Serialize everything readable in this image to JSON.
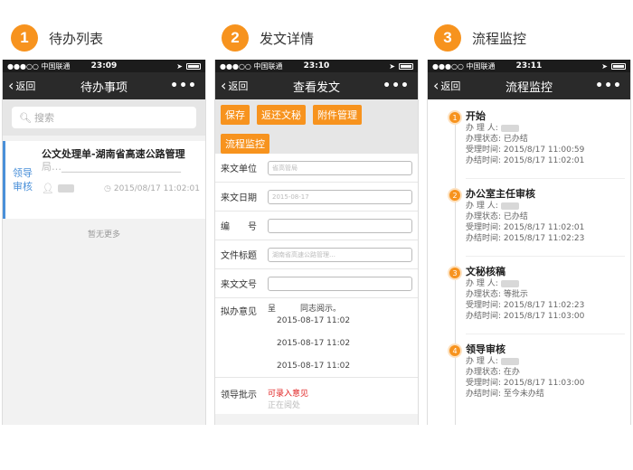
{
  "steps": [
    {
      "num": "1",
      "label": "待办列表"
    },
    {
      "num": "2",
      "label": "发文详情"
    },
    {
      "num": "3",
      "label": "流程监控"
    }
  ],
  "status_bar": {
    "carrier": "●●●○○ 中国联通",
    "times": [
      "23:09",
      "23:10",
      "23:11"
    ]
  },
  "nav": {
    "back_label": "返回",
    "more": "•••",
    "titles": [
      "待办事项",
      "查看发文",
      "流程监控"
    ]
  },
  "todo": {
    "search_placeholder": "搜索",
    "item": {
      "tag_line1": "领导",
      "tag_line2": "审核",
      "title": "公文处理单-湖南省高速公路管理",
      "title_line2": "局…________________________",
      "datetime": "2015/08/17 11:02:01"
    },
    "no_more": "暂无更多"
  },
  "detail": {
    "buttons": [
      "保存",
      "返还文秘",
      "附件管理",
      "流程监控"
    ],
    "fields": [
      {
        "label": "来文单位",
        "value": "省高管局"
      },
      {
        "label": "来文日期",
        "value": "2015-08-17"
      },
      {
        "label": "编　　号",
        "value": ""
      },
      {
        "label": "文件标题",
        "value": "湖南省高速公路管理…"
      },
      {
        "label": "来文文号",
        "value": ""
      }
    ],
    "opinion_label": "拟办意见",
    "opinion_lines": [
      "呈　　　同志阅示。",
      "2015-08-17 11:02",
      "2015-08-17 11:02",
      "2015-08-17 11:02"
    ],
    "leader_label": "领导批示",
    "leader_value": "可录入意见",
    "leader_value2": "正在阅处"
  },
  "flow": {
    "labels": {
      "handler": "办 理 人:",
      "state": "办理状态:",
      "accept": "受理时间:",
      "finish": "办结时间:"
    },
    "steps": [
      {
        "num": "1",
        "name": "开始",
        "state": "已办结",
        "accept": "2015/8/17 11:00:59",
        "finish": "2015/8/17 11:02:01"
      },
      {
        "num": "2",
        "name": "办公室主任审核",
        "state": "已办结",
        "accept": "2015/8/17 11:02:01",
        "finish": "2015/8/17 11:02:23"
      },
      {
        "num": "3",
        "name": "文秘核稿",
        "state": "等批示",
        "accept": "2015/8/17 11:02:23",
        "finish": "2015/8/17 11:03:00"
      },
      {
        "num": "4",
        "name": "领导审核",
        "state": "在办",
        "accept": "2015/8/17 11:03:00",
        "finish": "至今未办结"
      }
    ]
  },
  "colors": {
    "accent": "#f7931e",
    "nav": "#2a2a2a",
    "link_blue": "#4a90d9",
    "red": "#e02020"
  }
}
